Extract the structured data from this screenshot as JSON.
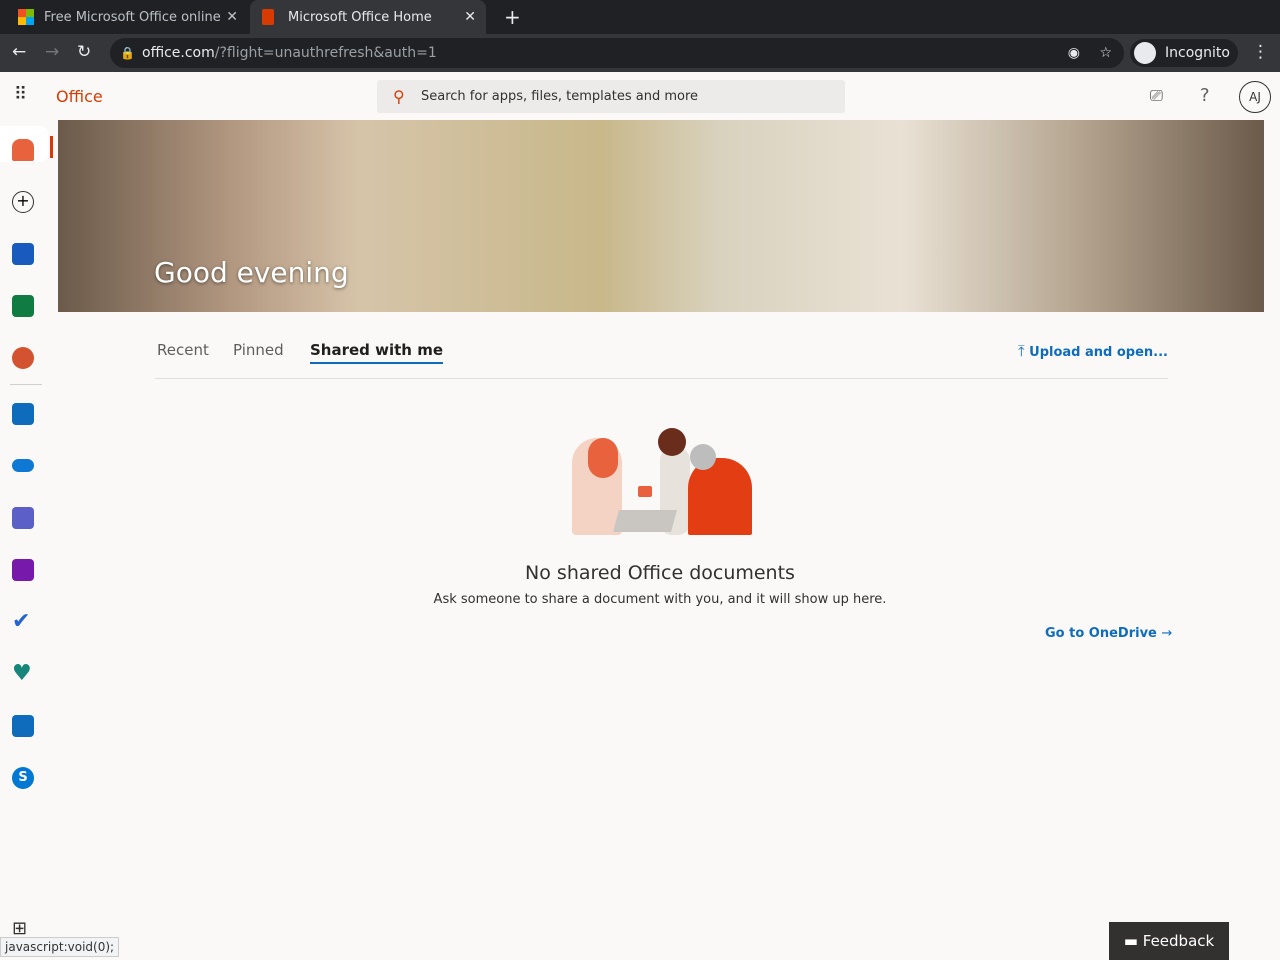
{
  "browser": {
    "tabs": [
      {
        "title": "Free Microsoft Office online"
      },
      {
        "title": "Microsoft Office Home"
      }
    ],
    "url_host": "office.com",
    "url_path": "/?flight=unauthrefresh&auth=1",
    "profile": "Incognito"
  },
  "header": {
    "brand": "Office",
    "search_placeholder": "Search for apps, files, templates and more",
    "avatar": "AJ"
  },
  "banner": {
    "greeting": "Good evening"
  },
  "tabs": [
    {
      "label": "Recent"
    },
    {
      "label": "Pinned"
    },
    {
      "label": "Shared with me"
    }
  ],
  "upload_label": "Upload and open...",
  "empty": {
    "title": "No shared Office documents",
    "subtitle": "Ask someone to share a document with you, and it will show up here."
  },
  "onedrive_link": "Go to OneDrive",
  "feedback": "Feedback",
  "status_bar": "javascript:void(0);",
  "sidebar": {
    "apps": [
      {
        "name": "home",
        "color": "#e8623d"
      },
      {
        "name": "create",
        "color": "#ffffff"
      },
      {
        "name": "word",
        "color": "#185abd"
      },
      {
        "name": "excel",
        "color": "#107c41"
      },
      {
        "name": "powerpoint",
        "color": "#d35230"
      },
      {
        "name": "outlook",
        "color": "#0f6cbd"
      },
      {
        "name": "onedrive",
        "color": "#0f78d4"
      },
      {
        "name": "teams",
        "color": "#5b5fc7"
      },
      {
        "name": "onenote",
        "color": "#7719aa"
      },
      {
        "name": "todo",
        "color": "#2564cf"
      },
      {
        "name": "family-safety",
        "color": "#16857a"
      },
      {
        "name": "calendar",
        "color": "#0f6cbd"
      },
      {
        "name": "skype",
        "color": "#0078d4"
      }
    ]
  }
}
